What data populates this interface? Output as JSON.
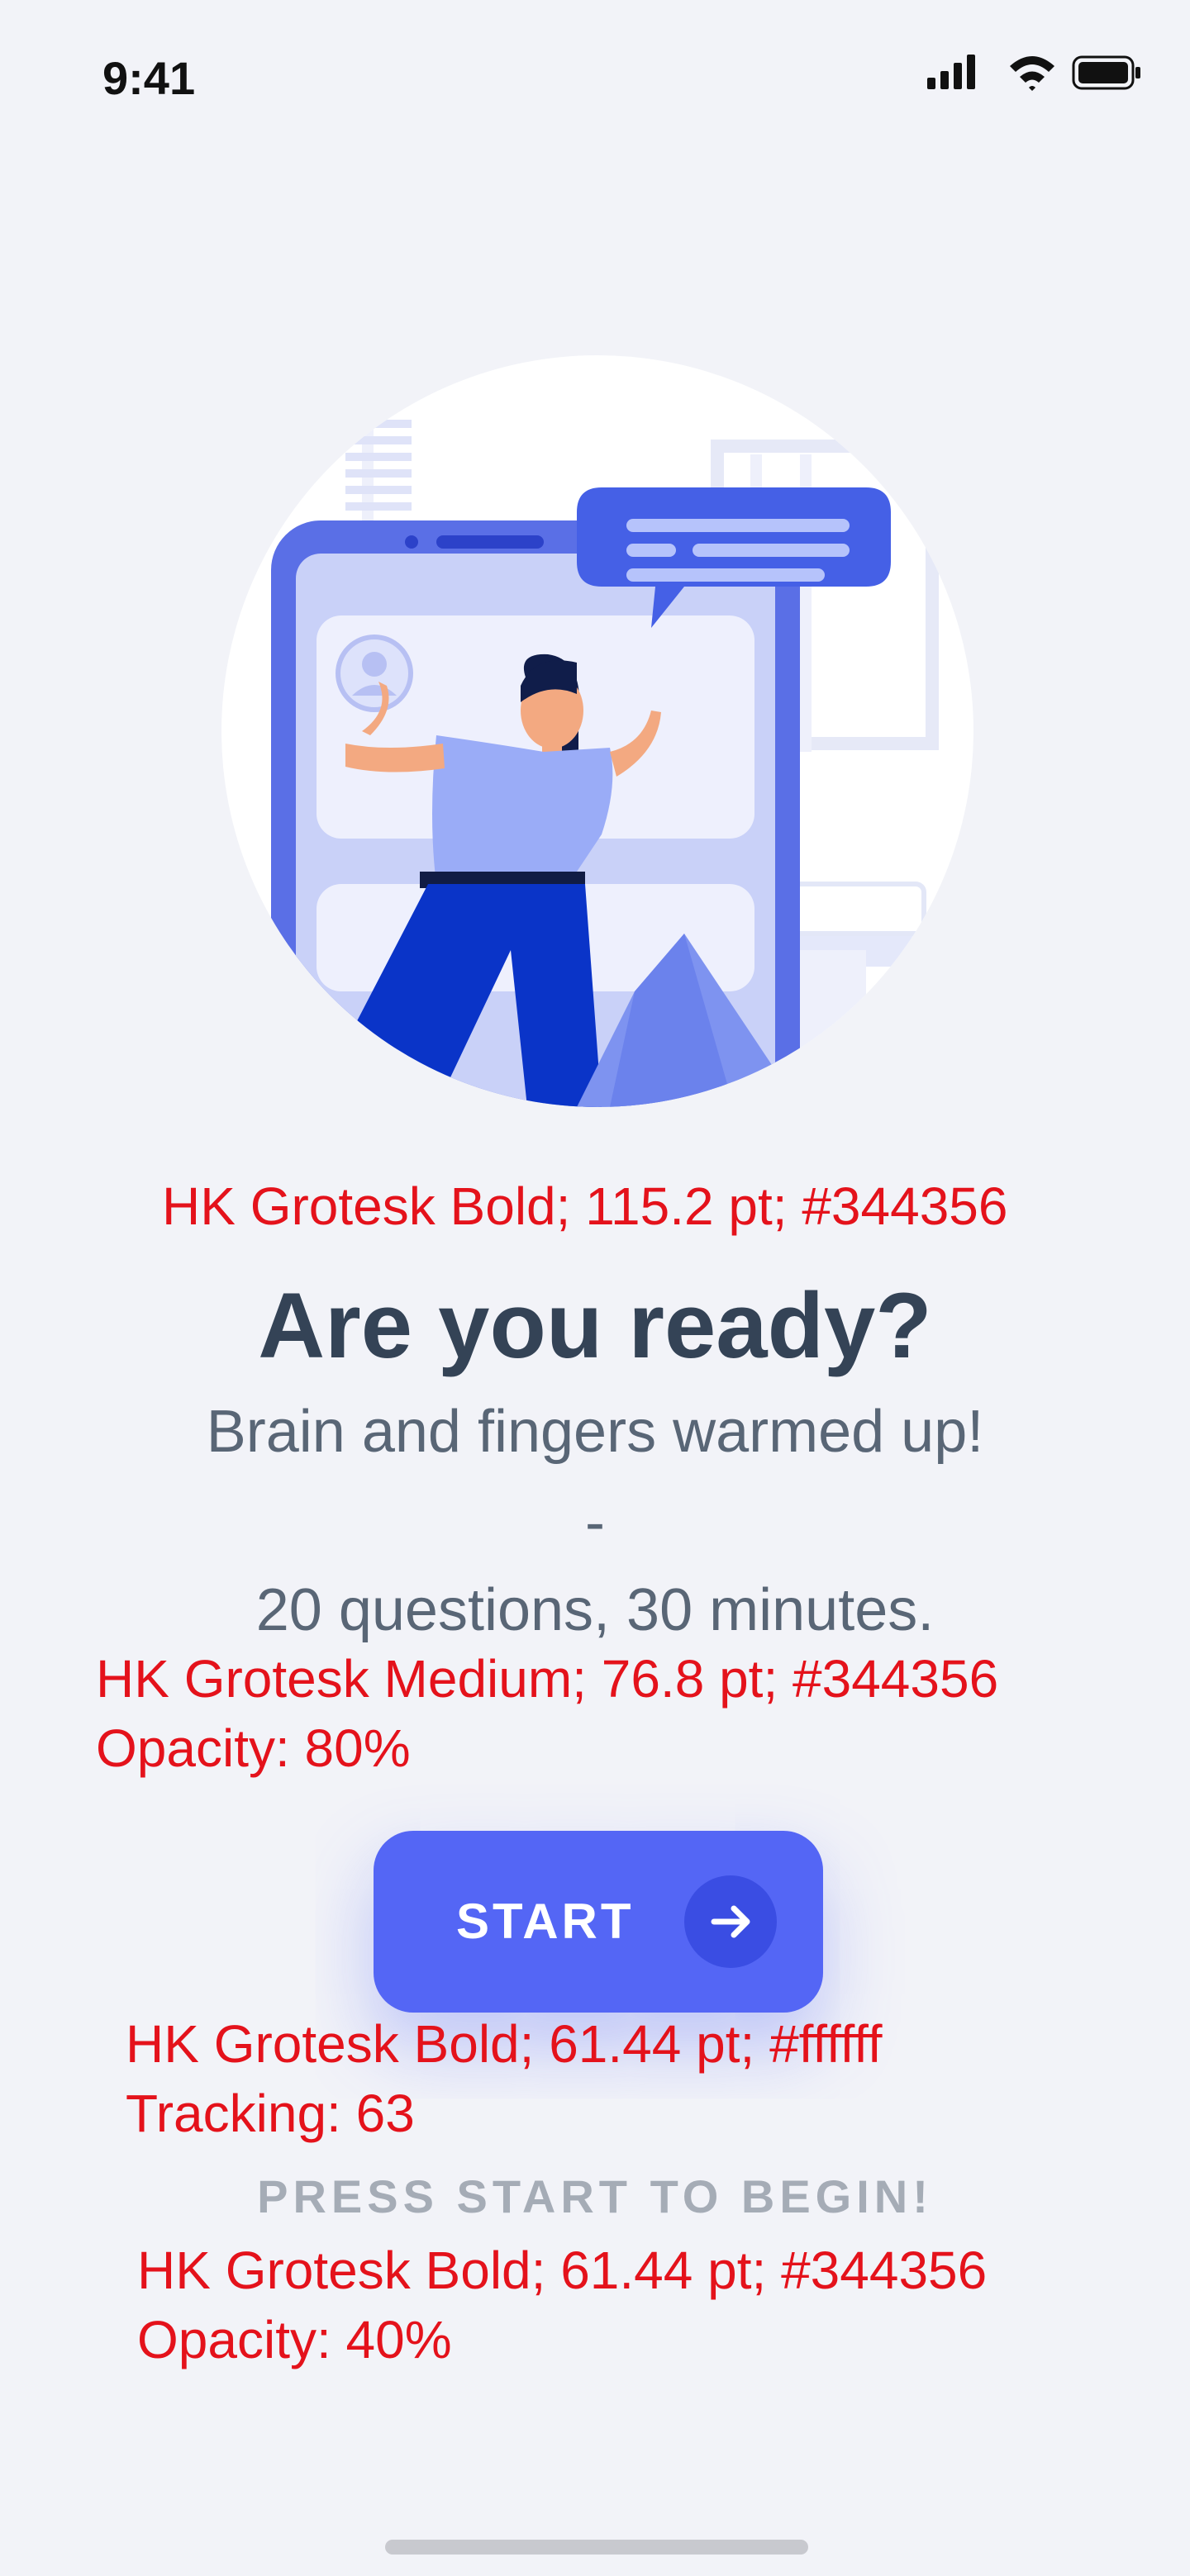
{
  "status_bar": {
    "time": "9:41"
  },
  "content": {
    "title": "Are you ready?",
    "subtitle_line1": "Brain and fingers warmed up!",
    "subtitle_dash": "-",
    "subtitle_line2": "20 questions, 30 minutes.",
    "start_button_label": "START",
    "hint": "PRESS START TO BEGIN!"
  },
  "annotations": {
    "title_spec": "HK Grotesk Bold; 115.2 pt; #344356",
    "subtitle_spec_line1": "HK Grotesk Medium; 76.8 pt; #344356",
    "subtitle_spec_line2": "Opacity: 80%",
    "button_spec_line1": "HK Grotesk Bold; 61.44 pt; #ffffff",
    "button_spec_line2": "Tracking: 63",
    "hint_spec_line1": "HK Grotesk Bold; 61.44 pt; #344356",
    "hint_spec_line2": "Opacity: 40%"
  },
  "colors": {
    "background": "#f2f3f8",
    "text_primary": "#344356",
    "accent": "#5466f5",
    "annotation_red": "#e4121b"
  },
  "icons": [
    "signal-icon",
    "wifi-icon",
    "battery-icon",
    "arrow-right-icon"
  ]
}
